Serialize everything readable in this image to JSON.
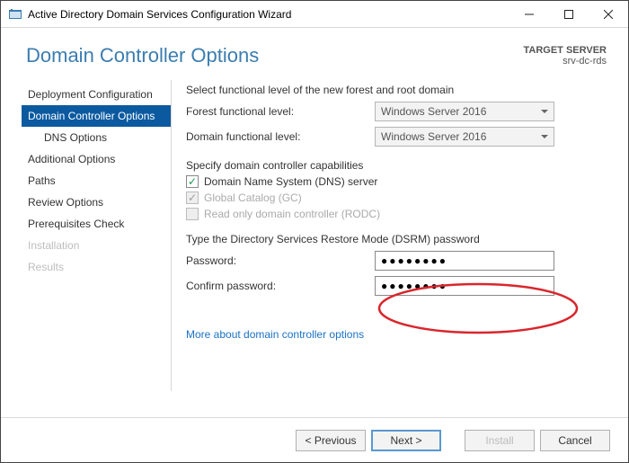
{
  "window": {
    "title": "Active Directory Domain Services Configuration Wizard"
  },
  "header": {
    "title": "Domain Controller Options",
    "target_label": "TARGET SERVER",
    "target_value": "srv-dc-rds"
  },
  "nav": {
    "items": [
      {
        "label": "Deployment Configuration"
      },
      {
        "label": "Domain Controller Options"
      },
      {
        "label": "DNS Options"
      },
      {
        "label": "Additional Options"
      },
      {
        "label": "Paths"
      },
      {
        "label": "Review Options"
      },
      {
        "label": "Prerequisites Check"
      },
      {
        "label": "Installation"
      },
      {
        "label": "Results"
      }
    ]
  },
  "main": {
    "section1_heading": "Select functional level of the new forest and root domain",
    "forest_label": "Forest functional level:",
    "forest_value": "Windows Server 2016",
    "domain_label": "Domain functional level:",
    "domain_value": "Windows Server 2016",
    "section2_heading": "Specify domain controller capabilities",
    "dns_label": "Domain Name System (DNS) server",
    "gc_label": "Global Catalog (GC)",
    "rodc_label": "Read only domain controller (RODC)",
    "section3_heading": "Type the Directory Services Restore Mode (DSRM) password",
    "password_label": "Password:",
    "password_value": "●●●●●●●●",
    "confirm_label": "Confirm password:",
    "confirm_value": "●●●●●●●●",
    "link": "More about domain controller options"
  },
  "footer": {
    "previous": "< Previous",
    "next": "Next >",
    "install": "Install",
    "cancel": "Cancel"
  }
}
